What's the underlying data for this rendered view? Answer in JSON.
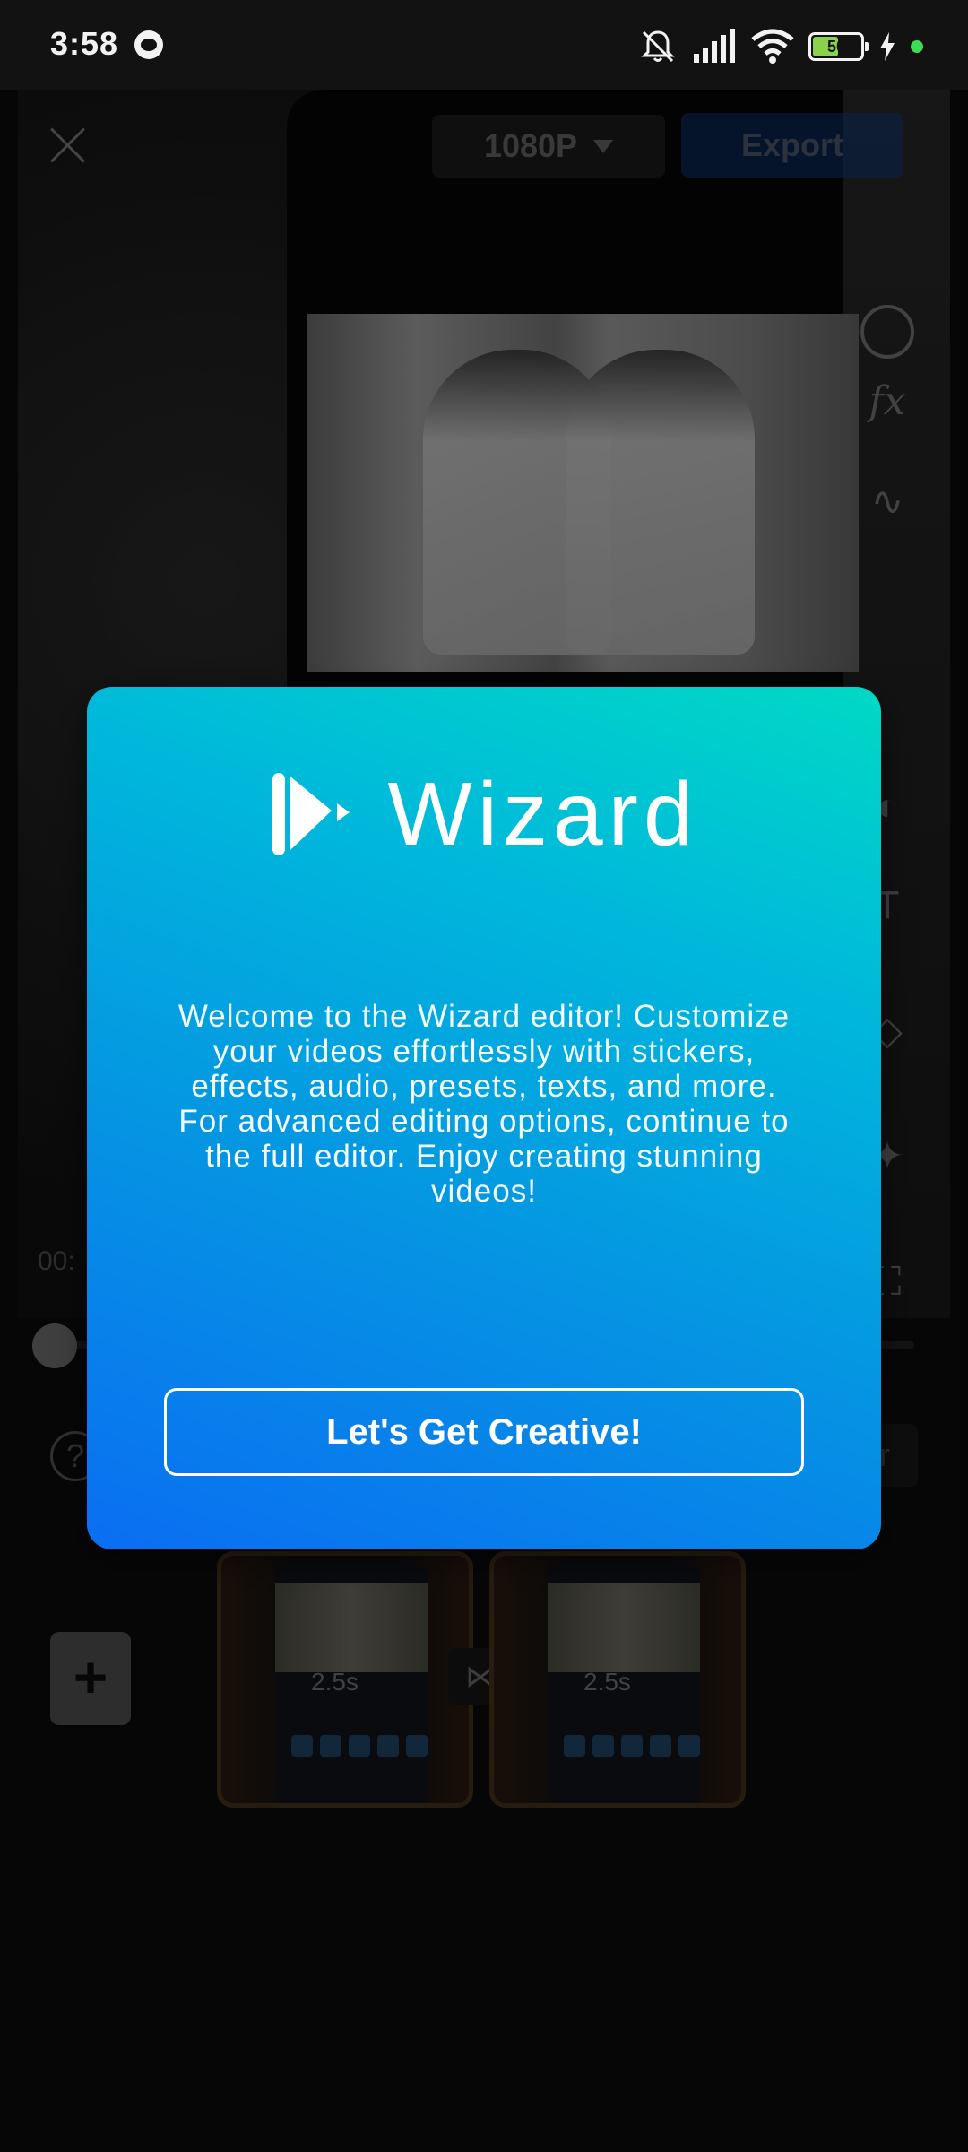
{
  "status_bar": {
    "time": "3:58",
    "battery_level": "50"
  },
  "editor": {
    "resolution": "1080P",
    "export_label": "Export",
    "time_partial": "00:",
    "right_button_partial": "r",
    "clips": [
      {
        "duration": "2.5s"
      },
      {
        "duration": "2.5s"
      }
    ],
    "tools": [
      "sticker-icon",
      "fx-icon",
      "audio-wave-icon",
      "preset-icon",
      "text-icon",
      "paint-bucket-icon",
      "magic-wand-icon",
      "crop-icon"
    ]
  },
  "modal": {
    "brand_name": "Wizard",
    "welcome_text": "Welcome to the Wizard editor! Customize your videos effortlessly with stickers, effects, audio, presets, texts, and more. For advanced editing options, continue to the full editor. Enjoy creating stunning videos!",
    "cta_label": "Let's Get Creative!",
    "gradient_colors": [
      "#00d9c6",
      "#0a6ef2"
    ]
  }
}
